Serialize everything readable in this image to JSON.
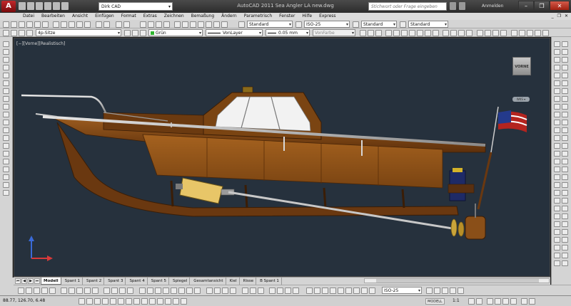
{
  "titlebar": {
    "app_letter": "A",
    "workspace": "Dirk CAD",
    "title": "AutoCAD 2011   Sea Angler LA new.dwg",
    "search_placeholder": "Stichwort oder Frage eingeben",
    "login": "Anmelden",
    "minimize": "–",
    "restore": "❐",
    "close": "✕"
  },
  "menu": {
    "items": [
      "Datei",
      "Bearbeiten",
      "Ansicht",
      "Einfügen",
      "Format",
      "Extras",
      "Zeichnen",
      "Bemaßung",
      "Ändern",
      "Parametrisch",
      "Fenster",
      "Hilfe",
      "Express"
    ]
  },
  "toolbar1": {
    "textstyle": "Standard",
    "dimstyle": "ISO-25",
    "tablestyle": "Standard",
    "mleaderstyle": "Standard"
  },
  "toolbar2": {
    "layer": "4p-Sitze",
    "color": "Grün",
    "color_hex": "#2fb52f",
    "linetype": "VonLayer",
    "lineweight": "0.05 mm",
    "plotstyle": "VonFarbe"
  },
  "viewport": {
    "label": "[−][Vorne][Realistisch]",
    "viewcube_face": "VORNE",
    "wcs_button": "WKS ▾"
  },
  "tabs": [
    "Modell",
    "Spant 1",
    "Spant 2",
    "Spant 3",
    "Spant 4",
    "Spant 5",
    "Spiegel",
    "Gesamtansicht",
    "Kiel",
    "Risse",
    "B Spant 1"
  ],
  "bottom_toolbar": {
    "dimstyle": "ISO-25"
  },
  "status": {
    "coords": "88.77,  126.70,  6.48",
    "model": "MODELL",
    "scale": "1:1"
  },
  "colors": {
    "viewport_bg": "#26313d",
    "hull_brown": "#7a4413",
    "cabin_brown": "#8d5218",
    "accent_red": "#b4241f"
  }
}
